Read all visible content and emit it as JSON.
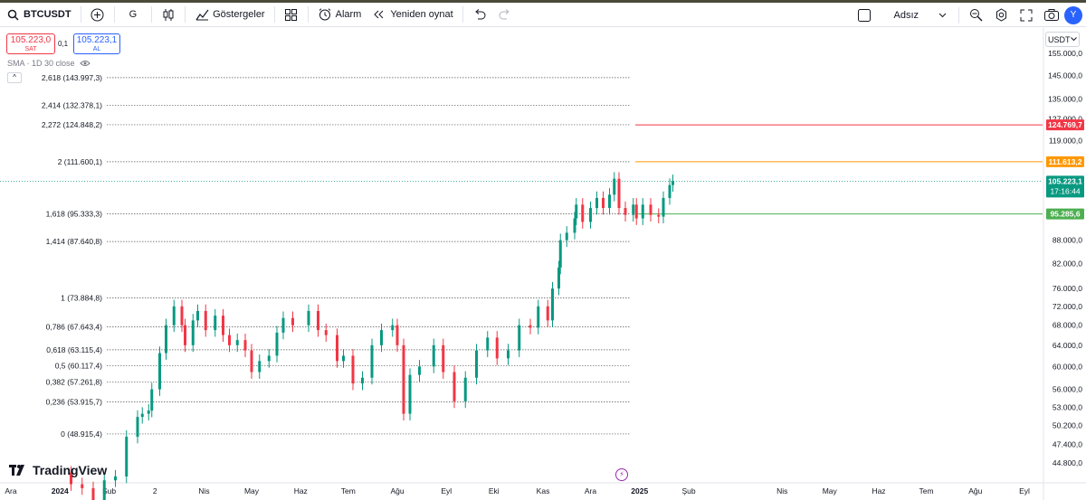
{
  "toolbar": {
    "symbol": "BTCUSDT",
    "interval": "G",
    "indicators_label": "Göstergeler",
    "alarm_label": "Alarm",
    "replay_label": "Yeniden oynat",
    "layout_name": "Adsız",
    "avatar_letter": "Y"
  },
  "order_panel": {
    "sell_price": "105.223,0",
    "sell_label": "SAT",
    "spread": "0,1",
    "buy_price": "105.223,1",
    "buy_label": "AL"
  },
  "indicator_legend": "SMA · 1D 30 close",
  "collapse_symbol": "^",
  "currency": "USDT",
  "logo_text": "TradingView",
  "chart_data": {
    "type": "candlestick",
    "symbol": "BTCUSDT",
    "timeframe": "1D",
    "y_scale": "log",
    "price_ticks": [
      "155.000,0",
      "145.000,0",
      "135.000,0",
      "127.000,0",
      "119.000,0",
      "88.000,0",
      "82.000,0",
      "76.000,0",
      "72.000,0",
      "68.000,0",
      "64.000,0",
      "60.000,0",
      "56.000,0",
      "53.000,0",
      "50.200,0",
      "47.400,0",
      "44.800,0"
    ],
    "price_tick_values": [
      155000,
      145000,
      135000,
      127000,
      119000,
      88000,
      82000,
      76000,
      72000,
      68000,
      64000,
      60000,
      56000,
      53000,
      50200,
      47400,
      44800
    ],
    "time_ticks": [
      "Ara",
      "2024",
      "Şub",
      "2",
      "Nis",
      "May",
      "Haz",
      "Tem",
      "Ağu",
      "Eyl",
      "Eki",
      "Kas",
      "Ara",
      "2025",
      "Şub",
      "Nis",
      "May",
      "Haz",
      "Tem",
      "Ağu",
      "Eyl"
    ],
    "time_tick_dates": [
      "2023-12-01",
      "2024-01-01",
      "2024-02-01",
      "2024-03-01",
      "2024-04-01",
      "2024-05-01",
      "2024-06-01",
      "2024-07-01",
      "2024-08-01",
      "2024-09-01",
      "2024-10-01",
      "2024-11-01",
      "2024-12-01",
      "2025-01-01",
      "2025-02-01",
      "2025-04-01",
      "2025-05-01",
      "2025-06-01",
      "2025-07-01",
      "2025-08-01",
      "2025-09-01"
    ],
    "fib_levels": [
      {
        "label": "2,618 (143.997,3)",
        "price": 143997.3
      },
      {
        "label": "2,414 (132.378,1)",
        "price": 132378.1
      },
      {
        "label": "2,272 (124.848,2)",
        "price": 124848.2
      },
      {
        "label": "2 (111.600,1)",
        "price": 111600.1
      },
      {
        "label": "1,618 (95.333,3)",
        "price": 95333.3
      },
      {
        "label": "1,414 (87.640,8)",
        "price": 87640.8
      },
      {
        "label": "1 (73.884,8)",
        "price": 73884.8
      },
      {
        "label": "0,786 (67.643,4)",
        "price": 67643.4
      },
      {
        "label": "0,618 (63.115,4)",
        "price": 63115.4
      },
      {
        "label": "0,5 (60.117,4)",
        "price": 60117.4
      },
      {
        "label": "0,382 (57.261,8)",
        "price": 57261.8
      },
      {
        "label": "0,236 (53.915,7)",
        "price": 53915.7
      },
      {
        "label": "0 (48.915,4)",
        "price": 48915.4
      }
    ],
    "horizontal_lines": [
      {
        "price": 124769.7,
        "label": "124.769,7",
        "color": "#f23645"
      },
      {
        "price": 111613.2,
        "label": "111.613,2",
        "color": "#ff9800"
      },
      {
        "price": 95285.6,
        "label": "95.285,6",
        "color": "#4caf50"
      }
    ],
    "last_price": {
      "label": "105.223,1",
      "countdown": "17:16:44",
      "color": "#089981",
      "price": 105223.1
    },
    "up_color": "#089981",
    "down_color": "#f23645",
    "closes": [
      [
        43500,
        "2024-01-01"
      ],
      [
        42000,
        "2024-01-08"
      ],
      [
        41500,
        "2024-01-15"
      ],
      [
        40000,
        "2024-01-22"
      ],
      [
        42500,
        "2024-01-29"
      ],
      [
        43000,
        "2024-02-05"
      ],
      [
        48500,
        "2024-02-12"
      ],
      [
        51500,
        "2024-02-19"
      ],
      [
        52000,
        "2024-02-22"
      ],
      [
        52500,
        "2024-02-26"
      ],
      [
        56000,
        "2024-02-28"
      ],
      [
        62500,
        "2024-03-04"
      ],
      [
        68000,
        "2024-03-08"
      ],
      [
        72000,
        "2024-03-13"
      ],
      [
        68000,
        "2024-03-18"
      ],
      [
        64000,
        "2024-03-20"
      ],
      [
        69000,
        "2024-03-25"
      ],
      [
        71000,
        "2024-03-28"
      ],
      [
        67000,
        "2024-04-02"
      ],
      [
        70000,
        "2024-04-08"
      ],
      [
        66000,
        "2024-04-13"
      ],
      [
        64000,
        "2024-04-17"
      ],
      [
        65000,
        "2024-04-22"
      ],
      [
        63000,
        "2024-04-27"
      ],
      [
        59000,
        "2024-05-01"
      ],
      [
        61000,
        "2024-05-06"
      ],
      [
        62000,
        "2024-05-12"
      ],
      [
        66500,
        "2024-05-17"
      ],
      [
        69500,
        "2024-05-21"
      ],
      [
        68000,
        "2024-05-27"
      ],
      [
        71000,
        "2024-06-06"
      ],
      [
        67000,
        "2024-06-12"
      ],
      [
        66000,
        "2024-06-17"
      ],
      [
        61000,
        "2024-06-24"
      ],
      [
        62000,
        "2024-06-28"
      ],
      [
        57000,
        "2024-07-04"
      ],
      [
        58000,
        "2024-07-10"
      ],
      [
        64000,
        "2024-07-16"
      ],
      [
        67000,
        "2024-07-22"
      ],
      [
        68000,
        "2024-07-29"
      ],
      [
        64000,
        "2024-08-01"
      ],
      [
        52000,
        "2024-08-05"
      ],
      [
        58500,
        "2024-08-09"
      ],
      [
        60000,
        "2024-08-15"
      ],
      [
        64000,
        "2024-08-24"
      ],
      [
        59000,
        "2024-08-30"
      ],
      [
        54000,
        "2024-09-06"
      ],
      [
        58000,
        "2024-09-13"
      ],
      [
        63000,
        "2024-09-20"
      ],
      [
        65500,
        "2024-09-27"
      ],
      [
        61500,
        "2024-10-03"
      ],
      [
        63000,
        "2024-10-10"
      ],
      [
        68000,
        "2024-10-17"
      ],
      [
        67500,
        "2024-10-24"
      ],
      [
        72000,
        "2024-10-29"
      ],
      [
        69000,
        "2024-11-04"
      ],
      [
        76000,
        "2024-11-07"
      ],
      [
        81000,
        "2024-11-11"
      ],
      [
        88000,
        "2024-11-12"
      ],
      [
        90000,
        "2024-11-16"
      ],
      [
        94000,
        "2024-11-21"
      ],
      [
        98000,
        "2024-11-22"
      ],
      [
        93000,
        "2024-11-26"
      ],
      [
        97000,
        "2024-12-01"
      ],
      [
        100000,
        "2024-12-05"
      ],
      [
        97000,
        "2024-12-09"
      ],
      [
        101000,
        "2024-12-13"
      ],
      [
        106000,
        "2024-12-16"
      ],
      [
        97000,
        "2024-12-19"
      ],
      [
        95000,
        "2024-12-23"
      ],
      [
        98000,
        "2024-12-28"
      ],
      [
        94000,
        "2024-12-30"
      ],
      [
        98000,
        "2025-01-03"
      ],
      [
        95000,
        "2025-01-08"
      ],
      [
        94500,
        "2025-01-13"
      ],
      [
        100000,
        "2025-01-16"
      ],
      [
        104000,
        "2025-01-20"
      ],
      [
        105223.1,
        "2025-01-22"
      ]
    ]
  }
}
